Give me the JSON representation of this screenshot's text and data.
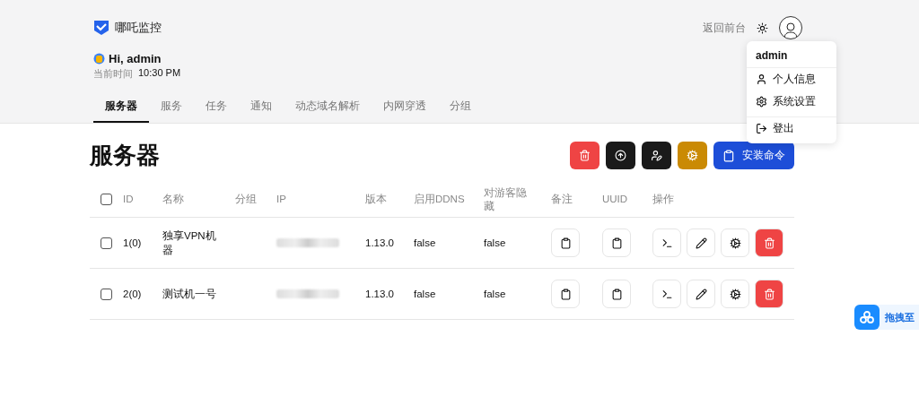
{
  "brand": {
    "name": "哪吒监控"
  },
  "header": {
    "back_link": "返回前台",
    "greeting": "Hi, admin",
    "time_label": "当前时间",
    "time": "10:30 PM"
  },
  "tabs": [
    {
      "label": "服务器",
      "selected": true
    },
    {
      "label": "服务",
      "selected": false
    },
    {
      "label": "任务",
      "selected": false
    },
    {
      "label": "通知",
      "selected": false
    },
    {
      "label": "动态域名解析",
      "selected": false
    },
    {
      "label": "内网穿透",
      "selected": false
    },
    {
      "label": "分组",
      "selected": false
    }
  ],
  "page_title": "服务器",
  "toolbar": [
    {
      "kind": "delete"
    },
    {
      "kind": "upgrade"
    },
    {
      "kind": "assign"
    },
    {
      "kind": "config"
    },
    {
      "kind": "install",
      "label": "安装命令"
    }
  ],
  "table": {
    "columns": [
      "ID",
      "名称",
      "分组",
      "IP",
      "版本",
      "启用DDNS",
      "对游客隐藏",
      "备注",
      "UUID",
      "操作"
    ],
    "select_all": {
      "checked": false
    },
    "rows": [
      {
        "checked": false,
        "id": "1(0)",
        "name": "独享VPN机器",
        "version": "1.13.0",
        "ddns": "false",
        "hidden": "false"
      },
      {
        "checked": false,
        "id": "2(0)",
        "name": "测试机一号",
        "version": "1.13.0",
        "ddns": "false",
        "hidden": "false"
      }
    ]
  },
  "user_menu": {
    "title": "admin",
    "items": [
      {
        "kind": "profile",
        "label": "个人信息"
      },
      {
        "kind": "settings",
        "label": "系统设置"
      },
      {
        "kind": "logout",
        "label": "登出"
      }
    ]
  },
  "floating_widget": {
    "label": "拖拽至"
  }
}
